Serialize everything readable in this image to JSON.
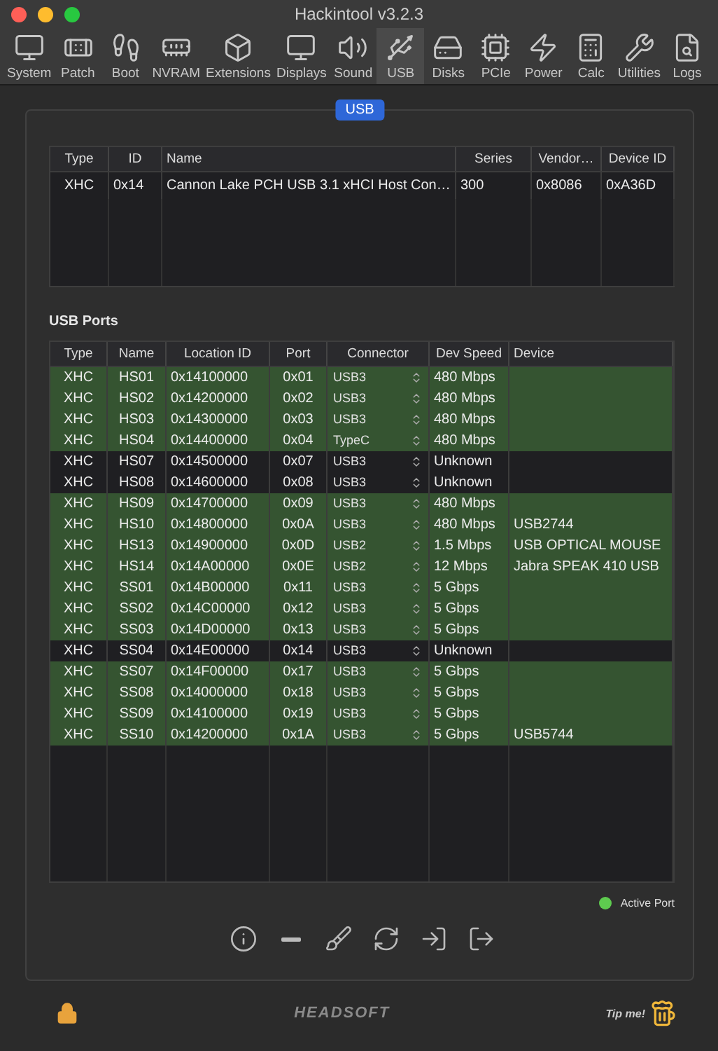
{
  "window": {
    "title": "Hackintool v3.2.3"
  },
  "toolbar": [
    {
      "label": "System",
      "selected": false
    },
    {
      "label": "Patch",
      "selected": false
    },
    {
      "label": "Boot",
      "selected": false
    },
    {
      "label": "NVRAM",
      "selected": false
    },
    {
      "label": "Extensions",
      "selected": false
    },
    {
      "label": "Displays",
      "selected": false
    },
    {
      "label": "Sound",
      "selected": false
    },
    {
      "label": "USB",
      "selected": true
    },
    {
      "label": "Disks",
      "selected": false
    },
    {
      "label": "PCIe",
      "selected": false
    },
    {
      "label": "Power",
      "selected": false
    },
    {
      "label": "Calc",
      "selected": false
    },
    {
      "label": "Utilities",
      "selected": false
    },
    {
      "label": "Logs",
      "selected": false
    }
  ],
  "section_tab": "USB",
  "controllers": {
    "columns": [
      "Type",
      "ID",
      "Name",
      "Series",
      "Vendor…",
      "Device ID"
    ],
    "rows": [
      [
        "XHC",
        "0x14",
        "Cannon Lake PCH USB 3.1 xHCI Host Con…",
        "300",
        "0x8086",
        "0xA36D"
      ]
    ]
  },
  "ports_title": "USB Ports",
  "ports": {
    "columns": [
      "Type",
      "Name",
      "Location ID",
      "Port",
      "Connector",
      "Dev Speed",
      "Device"
    ],
    "rows": [
      {
        "type": "XHC",
        "name": "HS01",
        "location": "0x14100000",
        "port": "0x01",
        "connector": "USB3",
        "speed": "480 Mbps",
        "device": "",
        "active": true
      },
      {
        "type": "XHC",
        "name": "HS02",
        "location": "0x14200000",
        "port": "0x02",
        "connector": "USB3",
        "speed": "480 Mbps",
        "device": "",
        "active": true
      },
      {
        "type": "XHC",
        "name": "HS03",
        "location": "0x14300000",
        "port": "0x03",
        "connector": "USB3",
        "speed": "480 Mbps",
        "device": "",
        "active": true
      },
      {
        "type": "XHC",
        "name": "HS04",
        "location": "0x14400000",
        "port": "0x04",
        "connector": "TypeC",
        "speed": "480 Mbps",
        "device": "",
        "active": true
      },
      {
        "type": "XHC",
        "name": "HS07",
        "location": "0x14500000",
        "port": "0x07",
        "connector": "USB3",
        "speed": "Unknown",
        "device": "",
        "active": false
      },
      {
        "type": "XHC",
        "name": "HS08",
        "location": "0x14600000",
        "port": "0x08",
        "connector": "USB3",
        "speed": "Unknown",
        "device": "",
        "active": false
      },
      {
        "type": "XHC",
        "name": "HS09",
        "location": "0x14700000",
        "port": "0x09",
        "connector": "USB3",
        "speed": "480 Mbps",
        "device": "",
        "active": true
      },
      {
        "type": "XHC",
        "name": "HS10",
        "location": "0x14800000",
        "port": "0x0A",
        "connector": "USB3",
        "speed": "480 Mbps",
        "device": "USB2744",
        "active": true
      },
      {
        "type": "XHC",
        "name": "HS13",
        "location": "0x14900000",
        "port": "0x0D",
        "connector": "USB2",
        "speed": "1.5 Mbps",
        "device": "USB OPTICAL MOUSE",
        "active": true
      },
      {
        "type": "XHC",
        "name": "HS14",
        "location": "0x14A00000",
        "port": "0x0E",
        "connector": "USB2",
        "speed": "12 Mbps",
        "device": "Jabra SPEAK 410 USB",
        "active": true
      },
      {
        "type": "XHC",
        "name": "SS01",
        "location": "0x14B00000",
        "port": "0x11",
        "connector": "USB3",
        "speed": "5 Gbps",
        "device": "",
        "active": true
      },
      {
        "type": "XHC",
        "name": "SS02",
        "location": "0x14C00000",
        "port": "0x12",
        "connector": "USB3",
        "speed": "5 Gbps",
        "device": "",
        "active": true
      },
      {
        "type": "XHC",
        "name": "SS03",
        "location": "0x14D00000",
        "port": "0x13",
        "connector": "USB3",
        "speed": "5 Gbps",
        "device": "",
        "active": true
      },
      {
        "type": "XHC",
        "name": "SS04",
        "location": "0x14E00000",
        "port": "0x14",
        "connector": "USB3",
        "speed": "Unknown",
        "device": "",
        "active": false
      },
      {
        "type": "XHC",
        "name": "SS07",
        "location": "0x14F00000",
        "port": "0x17",
        "connector": "USB3",
        "speed": "5 Gbps",
        "device": "",
        "active": true
      },
      {
        "type": "XHC",
        "name": "SS08",
        "location": "0x14000000",
        "port": "0x18",
        "connector": "USB3",
        "speed": "5 Gbps",
        "device": "",
        "active": true
      },
      {
        "type": "XHC",
        "name": "SS09",
        "location": "0x14100000",
        "port": "0x19",
        "connector": "USB3",
        "speed": "5 Gbps",
        "device": "",
        "active": true
      },
      {
        "type": "XHC",
        "name": "SS10",
        "location": "0x14200000",
        "port": "0x1A",
        "connector": "USB3",
        "speed": "5 Gbps",
        "device": "USB5744",
        "active": true
      }
    ]
  },
  "legend": {
    "label": "Active Port",
    "color": "#5ecb4f"
  },
  "footer": {
    "logo": "HEADSOFT",
    "tip": "Tip me!"
  }
}
